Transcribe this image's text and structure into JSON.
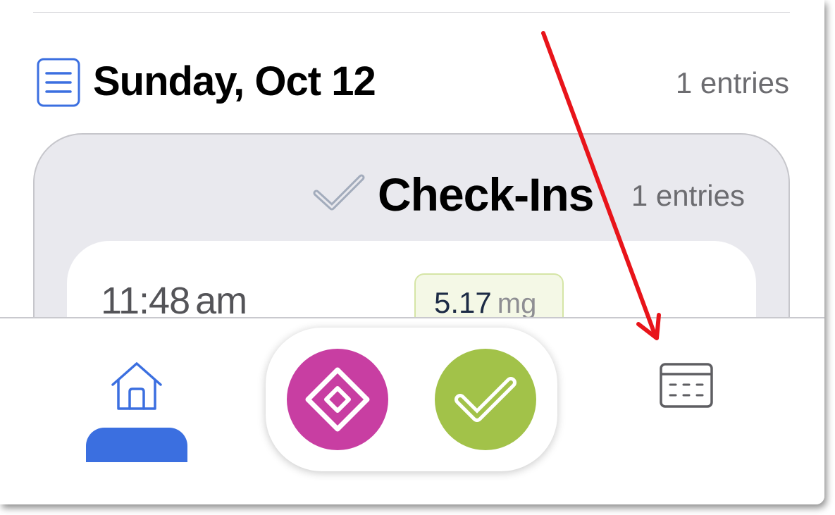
{
  "day": {
    "title": "Sunday, Oct 12",
    "count": "1 entries"
  },
  "group": {
    "title": "Check-Ins",
    "count": "1 entries"
  },
  "entry": {
    "time": "11:48",
    "ampm": "am",
    "dose_value": "5.17",
    "dose_unit": "mg"
  },
  "tabbar": {
    "items": [
      "home-icon",
      "log-item-diamond-icon",
      "check-in-icon",
      "calendar-icon"
    ],
    "selected": "home"
  },
  "colors": {
    "accent_blue": "#3b6fe0",
    "diamond_button": "#c83ea2",
    "check_button": "#a2c249",
    "annotation_arrow": "#e8141a"
  }
}
